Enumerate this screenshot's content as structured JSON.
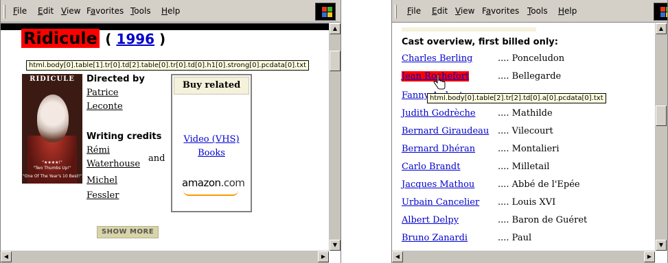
{
  "menu": {
    "items": [
      {
        "pre": "",
        "u": "F",
        "post": "ile"
      },
      {
        "pre": "",
        "u": "E",
        "post": "dit"
      },
      {
        "pre": "",
        "u": "V",
        "post": "iew"
      },
      {
        "pre": "F",
        "u": "a",
        "post": "vorites"
      },
      {
        "pre": "",
        "u": "T",
        "post": "ools"
      },
      {
        "pre": "",
        "u": "H",
        "post": "elp"
      }
    ]
  },
  "left": {
    "title": "Ridicule",
    "year_open": "(",
    "year": "1996",
    "year_close": ")",
    "tooltip": "html.body[0].table[1].tr[0].td[2].table[0].tr[0].td[0].h1[0].strong[0].pcdata[0].txt",
    "poster": {
      "title": "RIDICULE",
      "quote1": "\"★★★★!\"",
      "quote2": "\"Two Thumbs Up!\"",
      "quote3": "\"One Of The Year's 10 Best!\""
    },
    "directed_by": "Directed by",
    "director_first": "Patrice",
    "director_last": "Leconte",
    "writing_credits": "Writing credits",
    "writer1_first": "Rémi",
    "writer1_last": "Waterhouse",
    "and": "and",
    "writer2_first": "Michel",
    "writer2_last": "Fessler",
    "buy_related": "Buy related",
    "video": "Video (VHS)",
    "books": "Books",
    "amazon": "amazon",
    "amazon_com": ".com",
    "show_more": "SHOW MORE"
  },
  "right": {
    "cast_header": "Cast overview, first billed only:",
    "tooltip": "html.body[0].table[2].tr[2].td[0].a[0].pcdata[0].txt",
    "cast": [
      {
        "actor": "Charles Berling",
        "role": ".... Ponceludon"
      },
      {
        "actor": "Jean Rochefort",
        "role": ".... Bellegarde"
      },
      {
        "actor": "Fanny Ardant",
        "role": ""
      },
      {
        "actor": "Judith Godrèche",
        "role": ".... Mathilde"
      },
      {
        "actor": "Bernard Giraudeau",
        "role": ".... Vilecourt"
      },
      {
        "actor": "Bernard Dhéran",
        "role": ".... Montalieri"
      },
      {
        "actor": "Carlo Brandt",
        "role": ".... Milletail"
      },
      {
        "actor": "Jacques Mathou",
        "role": ".... Abbé de l'Epée"
      },
      {
        "actor": "Urbain Cancelier",
        "role": ".... Louis XVI"
      },
      {
        "actor": "Albert Delpy",
        "role": ".... Baron de Guéret"
      },
      {
        "actor": "Bruno Zanardi",
        "role": ".... Paul"
      }
    ]
  },
  "colors": {
    "highlight": "#ff0000",
    "link": "#0000cc",
    "chrome": "#d4d0c8"
  }
}
